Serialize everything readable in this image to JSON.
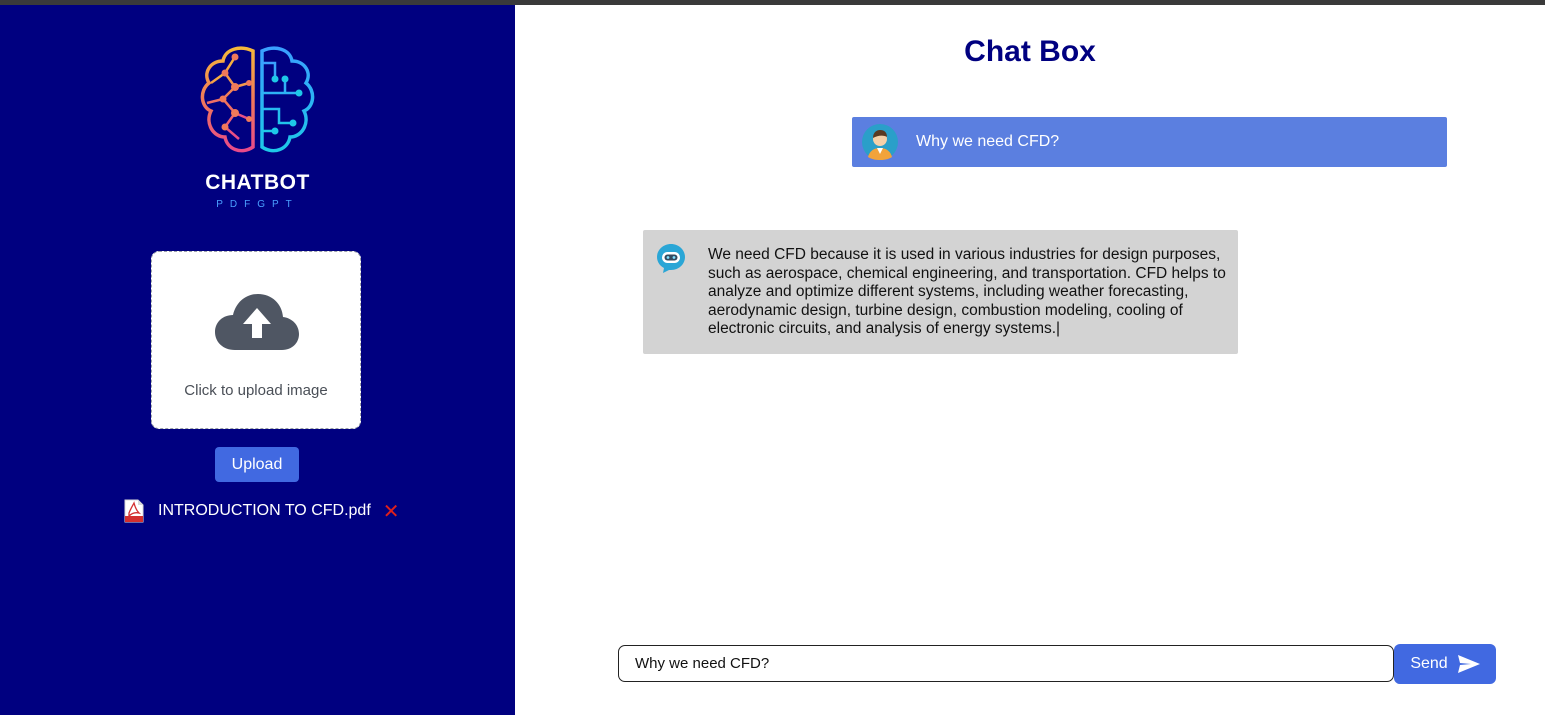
{
  "sidebar": {
    "brand_title": "CHATBOT",
    "brand_subtitle": "PDFGPT",
    "upload_prompt": "Click to upload image",
    "upload_button_label": "Upload",
    "uploaded_file": {
      "name": "INTRODUCTION TO CFD.pdf",
      "icon": "pdf-file-icon",
      "remove_icon": "close-icon"
    }
  },
  "chat": {
    "title": "Chat Box",
    "messages": [
      {
        "role": "user",
        "avatar": "user-avatar-icon",
        "text": "Why we need CFD?"
      },
      {
        "role": "bot",
        "avatar": "bot-avatar-icon",
        "text": "We need CFD because it is used in various industries for design purposes, such as aerospace, chemical engineering, and transportation. CFD helps to analyze and optimize different systems, including weather forecasting, aerodynamic design, turbine design, combustion modeling, cooling of electronic circuits, and analysis of energy systems.|"
      }
    ],
    "input_value": "Why we need CFD?",
    "send_label": "Send",
    "send_icon": "paper-plane-icon"
  },
  "colors": {
    "sidebar_bg": "#000080",
    "accent": "#4169e1",
    "user_bubble": "#5b7fe0",
    "bot_bubble": "#d3d3d3",
    "title": "#000080"
  }
}
